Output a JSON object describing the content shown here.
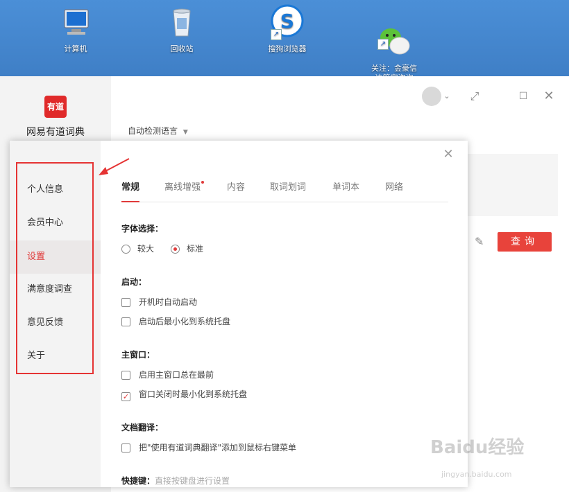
{
  "desktop": {
    "icons": [
      {
        "label": "计算机",
        "icon": "computer-icon"
      },
      {
        "label": "回收站",
        "icon": "recycle-bin-icon"
      },
      {
        "label": "搜狗浏览器",
        "icon": "sogou-browser-icon"
      },
      {
        "label": "关注：金豪信\n达管家咨询",
        "icon": "wechat-icon"
      }
    ]
  },
  "app": {
    "logo_text": "有道",
    "name": "网易有道词典",
    "lang_select": "自动检测语言",
    "query_button": "查询",
    "accent": "#e03a3a"
  },
  "dialog": {
    "sidebar": [
      {
        "label": "个人信息"
      },
      {
        "label": "会员中心"
      },
      {
        "label": "设置",
        "active": true
      },
      {
        "label": "满意度调查"
      },
      {
        "label": "意见反馈"
      },
      {
        "label": "关于"
      }
    ],
    "tabs": [
      {
        "label": "常规",
        "active": true
      },
      {
        "label": "离线增强",
        "dot": true
      },
      {
        "label": "内容"
      },
      {
        "label": "取词划词"
      },
      {
        "label": "单词本"
      },
      {
        "label": "网络"
      }
    ],
    "font": {
      "title": "字体选择：",
      "options": [
        {
          "label": "较大",
          "selected": false
        },
        {
          "label": "标准",
          "selected": true
        }
      ]
    },
    "startup": {
      "title": "启动：",
      "options": [
        {
          "label": "开机时自动启动",
          "checked": false
        },
        {
          "label": "启动后最小化到系统托盘",
          "checked": false
        }
      ]
    },
    "main_window": {
      "title": "主窗口：",
      "options": [
        {
          "label": "启用主窗口总在最前",
          "checked": false
        },
        {
          "label": "窗口关闭时最小化到系统托盘",
          "checked": true
        }
      ]
    },
    "doc_translate": {
      "title": "文档翻译：",
      "options": [
        {
          "label": "把\"使用有道词典翻译\"添加到鼠标右键菜单",
          "checked": false
        }
      ]
    },
    "hotkey": {
      "title": "快捷键：",
      "hint": "直接按键盘进行设置"
    }
  },
  "watermark": {
    "text": "Baidu经验",
    "sub": "jingyan.baidu.com"
  }
}
